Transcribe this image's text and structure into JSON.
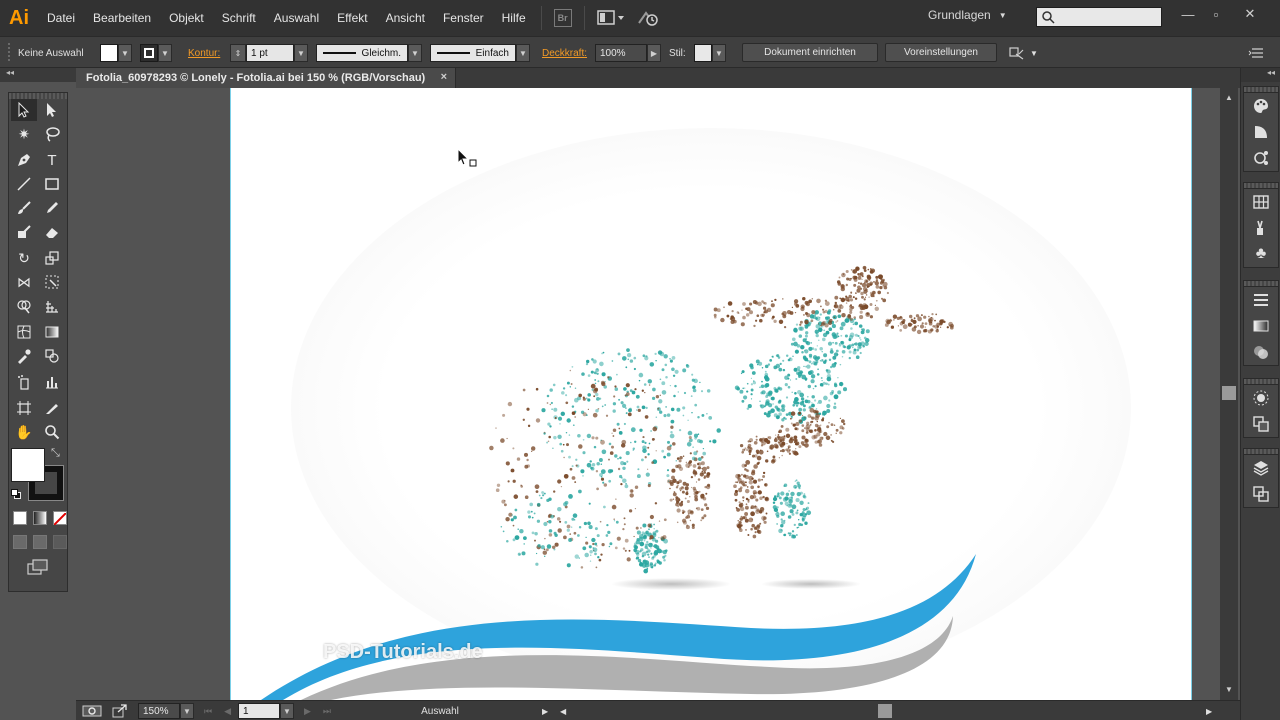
{
  "menubar": {
    "app_logo": "Ai",
    "items": [
      "Datei",
      "Bearbeiten",
      "Objekt",
      "Schrift",
      "Auswahl",
      "Effekt",
      "Ansicht",
      "Fenster",
      "Hilfe"
    ],
    "bridge_label": "Br",
    "workspace": "Grundlagen",
    "search_placeholder": ""
  },
  "controlbar": {
    "selection": "Keine Auswahl",
    "kontur_label": "Kontur:",
    "stroke_weight": "1 pt",
    "variable_width": "Gleichm.",
    "brush": "Einfach",
    "opacity_label": "Deckkraft:",
    "opacity_value": "100%",
    "style_label": "Stil:",
    "doc_setup_button": "Dokument einrichten",
    "preferences_button": "Voreinstellungen"
  },
  "document": {
    "tab_title": "Fotolia_60978293 © Lonely - Fotolia.ai bei 150 % (RGB/Vorschau)",
    "close_glyph": "×"
  },
  "statusbar": {
    "zoom": "150%",
    "artboard_number": "1",
    "status_text": "Auswahl"
  },
  "watermark": {
    "text": "PSD-Tutorials.de"
  },
  "colors": {
    "menubar_bg": "#323232",
    "accent_orange": "#f29a26",
    "swoosh_blue": "#2ea3dc",
    "swoosh_gray": "#b0b0b0",
    "particle_teal": "#2aa6a0",
    "particle_brown": "#7a4a2a"
  }
}
